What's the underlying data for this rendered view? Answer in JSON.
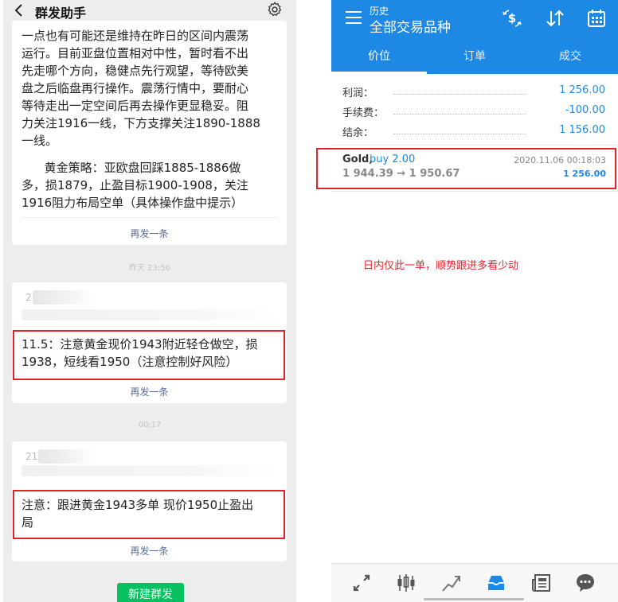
{
  "left": {
    "header": {
      "title": "群发助手"
    },
    "card1": {
      "lines": [
        "一点也有可能还是维持在昨日的区间内震荡",
        "运行。目前亚盘位置相对中性，暂时看不出",
        "先走哪个方向，稳健点先行观望，等待欧美",
        "盘之后临盘再行操作。震荡行情中，要耐心",
        "等待走出一定空间后再去操作更显稳妥。阻",
        "力关注1916一线，下方支撑关注1890-1888",
        "一线。",
        "",
        "      黄金策略：亚欧盘回踩1885-1886做",
        "多，损1879，止盈目标1900-1908，关注",
        "1916阻力布局空单（具体操作盘中提示）"
      ],
      "resend": "再发一条"
    },
    "ts1": "昨天 23:56",
    "card2": {
      "sender_prefix": "2",
      "lines": [
        "11.5：注意黄金现价1943附近轻仓做空，损",
        "1938，短线看1950（注意控制好风险）"
      ],
      "resend": "再发一条"
    },
    "ts2": "00:17",
    "card3": {
      "sender_prefix": "21",
      "lines": [
        "注意：跟进黄金1943多单 现价1950止盈出",
        "局"
      ],
      "resend": "再发一条"
    },
    "new_button": "新建群发"
  },
  "right": {
    "header": {
      "sub": "历史",
      "title": "全部交易品种"
    },
    "tabs": [
      "价位",
      "订单",
      "成交"
    ],
    "summary": [
      {
        "label": "利润：",
        "value": "1 256.00"
      },
      {
        "label": "手续费：",
        "value": "-100.00"
      },
      {
        "label": "结余：",
        "value": "1 156.00"
      }
    ],
    "order": {
      "symbol": "Gold,",
      "side": "buy 2.00",
      "prices": "1 944.39 → 1 950.67",
      "time": "2020.11.06 00:18:03",
      "profit": "1 256.00"
    },
    "annotation": "日内仅此一单，顺势跟进多看少动"
  },
  "colors": {
    "accent": "#1e88e5",
    "highlight": "#e0242b",
    "wechat_green": "#07c160"
  }
}
